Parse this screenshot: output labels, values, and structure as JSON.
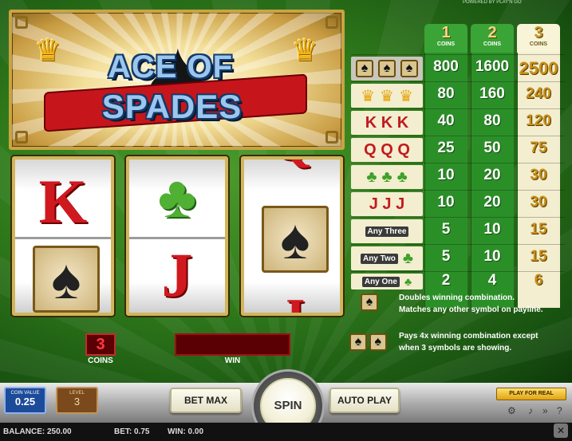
{
  "game": {
    "title_line1": "ACE OF",
    "title_line2": "SPADES",
    "header_note": "POWERED BY PLAY'N GO"
  },
  "paytable": {
    "columns": [
      {
        "num": "1",
        "label": "COINS"
      },
      {
        "num": "2",
        "label": "COINS"
      },
      {
        "num": "3",
        "label": "COINS"
      }
    ],
    "rows": [
      {
        "symbols": "spade-spade-spade",
        "values": [
          "800",
          "1600",
          "2500"
        ]
      },
      {
        "symbols": "crown-crown-crown",
        "values": [
          "80",
          "160",
          "240"
        ]
      },
      {
        "symbols": "K K K",
        "values": [
          "40",
          "80",
          "120"
        ]
      },
      {
        "symbols": "Q Q Q",
        "values": [
          "25",
          "50",
          "75"
        ]
      },
      {
        "symbols": "clover-clover-clover",
        "values": [
          "10",
          "20",
          "30"
        ]
      },
      {
        "symbols": "J J J",
        "values": [
          "10",
          "20",
          "30"
        ]
      },
      {
        "symbols": "Any Three",
        "values": [
          "5",
          "10",
          "15"
        ]
      },
      {
        "symbols": "Any Two",
        "values": [
          "5",
          "10",
          "15"
        ]
      },
      {
        "symbols": "Any One",
        "values": [
          "2",
          "4",
          "6"
        ]
      }
    ],
    "any_three": "Any Three",
    "any_two": "Any Two",
    "any_one": "Any One"
  },
  "rules": {
    "wild_line1": "Doubles winning combination.",
    "wild_line2": "Matches any other symbol on payline.",
    "double_line1": "Pays 4x winning combination except",
    "double_line2": "when 3 symbols are showing."
  },
  "reels": {
    "reel1": {
      "top": "K",
      "bottom": "spade"
    },
    "reel2": {
      "top": "clover",
      "bottom": "J"
    },
    "reel3": {
      "top": "Q",
      "middle": "spade",
      "bottom": "J"
    }
  },
  "controls": {
    "coins_value": "3",
    "coins_label": "COINS",
    "win_label": "WIN",
    "coin_value_label": "COIN VALUE",
    "coin_value": "0.25",
    "bet_level_label": "LEVEL",
    "bet_level": "3",
    "bet_max": "BET MAX",
    "spin": "SPIN",
    "auto_play": "AUTO PLAY",
    "play_for_real": "PLAY FOR REAL"
  },
  "status": {
    "balance": "BALANCE: 250.00",
    "bet": "BET: 0.75",
    "win": "WIN: 0.00"
  },
  "colors": {
    "felt": "#2f7a1b",
    "reel_frame": "#d1b65b",
    "paytable_green": "#2b8f28",
    "highlight": "#f3eecf"
  }
}
